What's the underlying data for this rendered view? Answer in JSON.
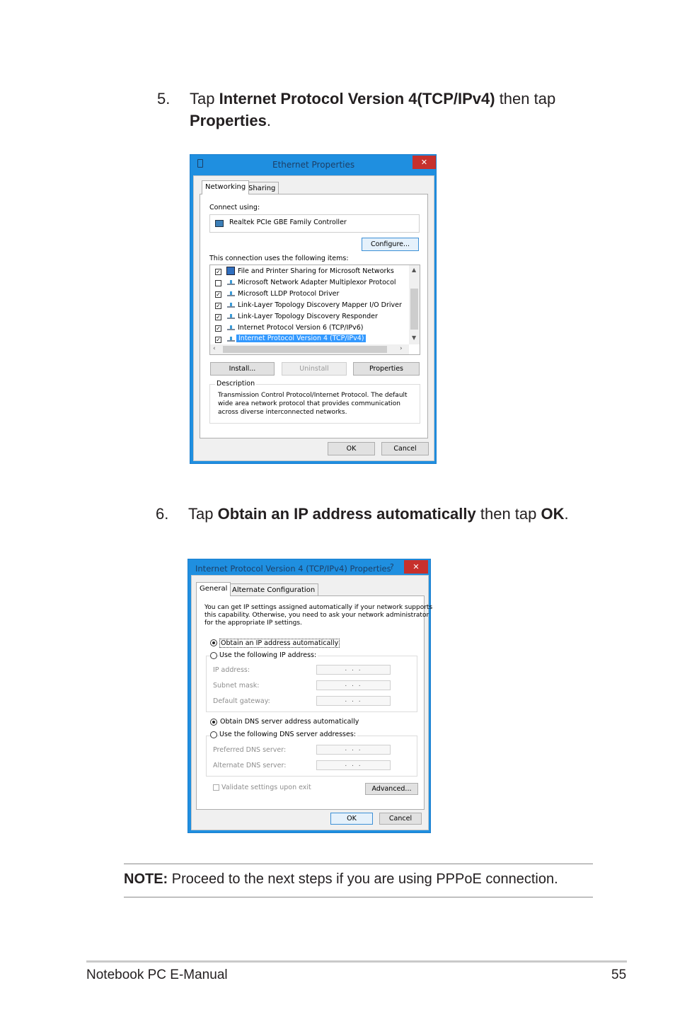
{
  "step5": {
    "number": "5.",
    "prefix": "Tap ",
    "bold1": "Internet Protocol Version 4(TCP/IPv4)",
    "mid": " then tap",
    "bold2": "Properties",
    "suffix": "."
  },
  "ethernet_dialog": {
    "title": "Ethernet Properties",
    "close": "✕",
    "tabs": [
      "Networking",
      "Sharing"
    ],
    "connect_using_label": "Connect using:",
    "adapter": "Realtek PCIe GBE Family Controller",
    "configure_button": "Configure...",
    "items_label": "This connection uses the following items:",
    "items": [
      {
        "checked": true,
        "label": "File and Printer Sharing for Microsoft Networks"
      },
      {
        "checked": false,
        "label": "Microsoft Network Adapter Multiplexor Protocol"
      },
      {
        "checked": true,
        "label": "Microsoft LLDP Protocol Driver"
      },
      {
        "checked": true,
        "label": "Link-Layer Topology Discovery Mapper I/O Driver"
      },
      {
        "checked": true,
        "label": "Link-Layer Topology Discovery Responder"
      },
      {
        "checked": true,
        "label": "Internet Protocol Version 6 (TCP/IPv6)"
      },
      {
        "checked": true,
        "label": "Internet Protocol Version 4 (TCP/IPv4)",
        "selected": true
      }
    ],
    "install_button": "Install...",
    "uninstall_button": "Uninstall",
    "properties_button": "Properties",
    "description_label": "Description",
    "description_lines": [
      "Transmission Control Protocol/Internet Protocol. The default",
      "wide area network protocol that provides communication",
      "across diverse interconnected networks."
    ],
    "ok_button": "OK",
    "cancel_button": "Cancel"
  },
  "step6": {
    "number": "6.",
    "prefix": "Tap ",
    "bold1": "Obtain an IP address automatically",
    "mid": " then tap ",
    "bold2": "OK",
    "suffix": "."
  },
  "ipv4_dialog": {
    "title": "Internet Protocol Version 4 (TCP/IPv4) Properties",
    "help": "?",
    "close": "✕",
    "tabs": [
      "General",
      "Alternate Configuration"
    ],
    "intro_lines": [
      "You can get IP settings assigned automatically if your network supports",
      "this capability. Otherwise, you need to ask your network administrator",
      "for the appropriate IP settings."
    ],
    "obtain_ip": "Obtain an IP address automatically",
    "use_ip": "Use the following IP address:",
    "ip_address": "IP address:",
    "subnet_mask": "Subnet mask:",
    "default_gateway": "Default gateway:",
    "ip_placeholder": ". . .",
    "obtain_dns": "Obtain DNS server address automatically",
    "use_dns": "Use the following DNS server addresses:",
    "preferred_dns": "Preferred DNS server:",
    "alternate_dns": "Alternate DNS server:",
    "validate": "Validate settings upon exit",
    "advanced_button": "Advanced...",
    "ok_button": "OK",
    "cancel_button": "Cancel"
  },
  "note": {
    "label": "NOTE:",
    "text": " Proceed to the next steps if you are using PPPoE connection."
  },
  "footer": {
    "title": "Notebook PC E-Manual",
    "page": "55"
  },
  "colors": {
    "window_frame": "#1f8fe0",
    "close_button": "#c7302c",
    "selection": "#3399ff"
  }
}
